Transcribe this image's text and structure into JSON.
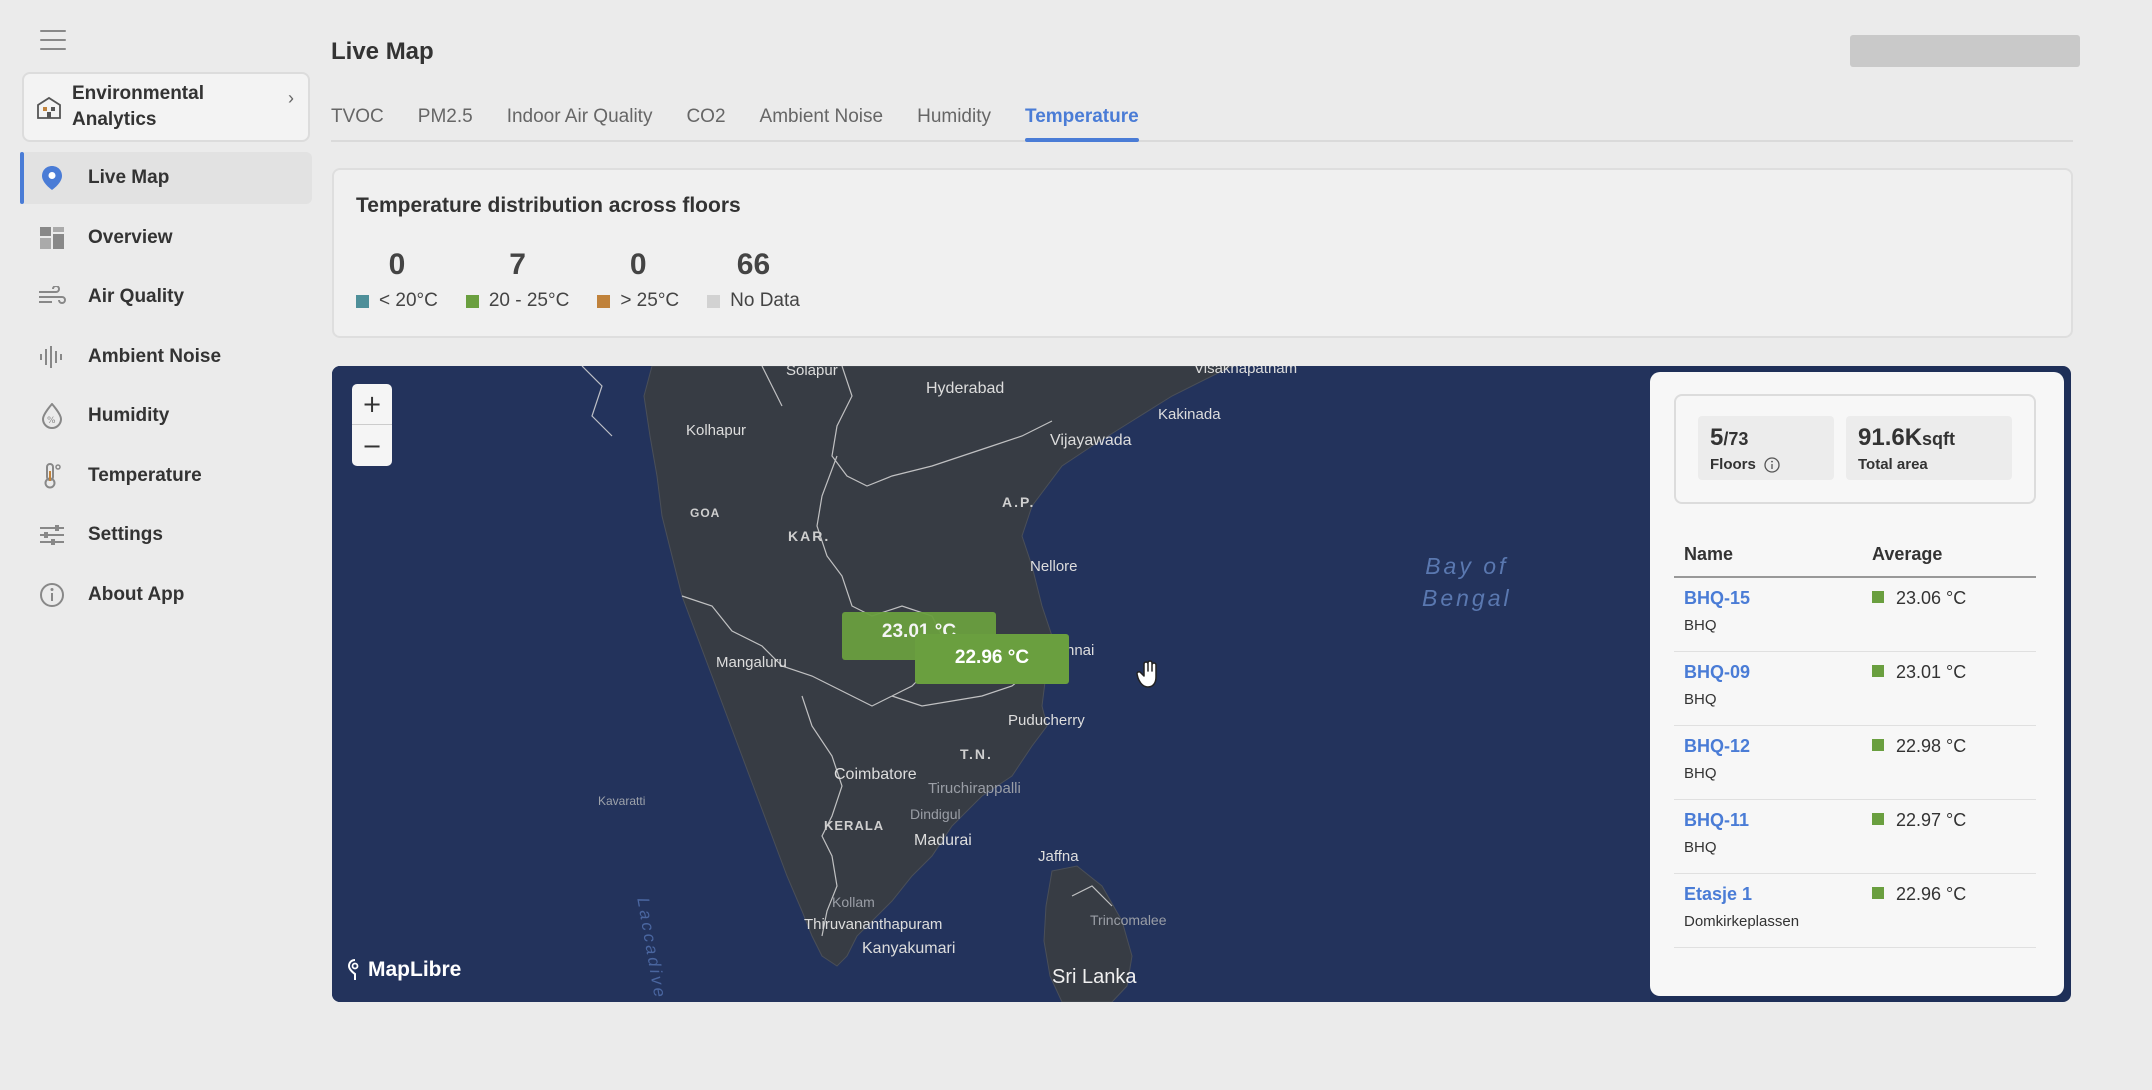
{
  "app": {
    "switcher_label": "Environmental Analytics",
    "page_title": "Live Map"
  },
  "sidebar": {
    "items": [
      {
        "label": "Live Map",
        "icon": "location-pin-icon",
        "active": true
      },
      {
        "label": "Overview",
        "icon": "dashboard-icon"
      },
      {
        "label": "Air Quality",
        "icon": "wind-icon"
      },
      {
        "label": "Ambient Noise",
        "icon": "sound-wave-icon"
      },
      {
        "label": "Humidity",
        "icon": "humidity-drop-icon"
      },
      {
        "label": "Temperature",
        "icon": "thermometer-icon"
      },
      {
        "label": "Settings",
        "icon": "sliders-icon"
      },
      {
        "label": "About App",
        "icon": "info-icon"
      }
    ]
  },
  "tabs": [
    {
      "label": "TVOC"
    },
    {
      "label": "PM2.5"
    },
    {
      "label": "Indoor Air Quality"
    },
    {
      "label": "CO2"
    },
    {
      "label": "Ambient Noise"
    },
    {
      "label": "Humidity"
    },
    {
      "label": "Temperature",
      "active": true
    }
  ],
  "distribution": {
    "title": "Temperature distribution across floors",
    "stats": [
      {
        "count": "0",
        "label": "< 20°C",
        "color": "#4e8f99"
      },
      {
        "count": "7",
        "label": "20 - 25°C",
        "color": "#6a9f3f"
      },
      {
        "count": "0",
        "label": "> 25°C",
        "color": "#c0823b"
      },
      {
        "count": "66",
        "label": "No Data",
        "color": "#d2d2d2"
      }
    ]
  },
  "map": {
    "zoom_in": "+",
    "zoom_out": "−",
    "attribution": "MapLibre",
    "sea_label": "Bay of Bengal",
    "sea_label_line1": "Bay of",
    "sea_label_line2": "Bengal",
    "laccadive": "Laccadive",
    "places": {
      "solapur": "Solapur",
      "hyderabad": "Hyderabad",
      "visakhapatnam": "Visakhapatnam",
      "kolhapur": "Kolhapur",
      "kakinada": "Kakinada",
      "vijayawada": "Vijayawada",
      "goa": "GOA",
      "kar": "KAR.",
      "ap": "A.P.",
      "nellore": "Nellore",
      "mangaluru": "Mangaluru",
      "chennai": "nnai",
      "puducherry": "Puducherry",
      "tn": "T.N.",
      "coimbatore": "Coimbatore",
      "tiruchirappalli": "Tiruchirappalli",
      "kavaratti": "Kavaratti",
      "kerala": "KERALA",
      "dindigul": "Dindigul",
      "madurai": "Madurai",
      "jaffna": "Jaffna",
      "kollam": "Kollam",
      "trincomalee": "Trincomalee",
      "thiruvananthapuram": "Thiruvananthapuram",
      "kanyakumari": "Kanyakumari",
      "srilanka": "Sri Lanka"
    },
    "markers": [
      {
        "label": "23.01 °C"
      },
      {
        "label": "22.96 °C"
      }
    ]
  },
  "summary": {
    "floors_value": "5",
    "floors_total": "/73",
    "floors_label": "Floors",
    "area_value": "91.6K",
    "area_unit": "sqft",
    "area_label": "Total area"
  },
  "table": {
    "headers": {
      "name": "Name",
      "average": "Average"
    },
    "rows": [
      {
        "name": "BHQ-15",
        "location": "BHQ",
        "average": "23.06 °C"
      },
      {
        "name": "BHQ-09",
        "location": "BHQ",
        "average": "23.01 °C"
      },
      {
        "name": "BHQ-12",
        "location": "BHQ",
        "average": "22.98 °C"
      },
      {
        "name": "BHQ-11",
        "location": "BHQ",
        "average": "22.97 °C"
      },
      {
        "name": "Etasje 1",
        "location": "Domkirkeplassen",
        "average": "22.96 °C"
      }
    ]
  }
}
